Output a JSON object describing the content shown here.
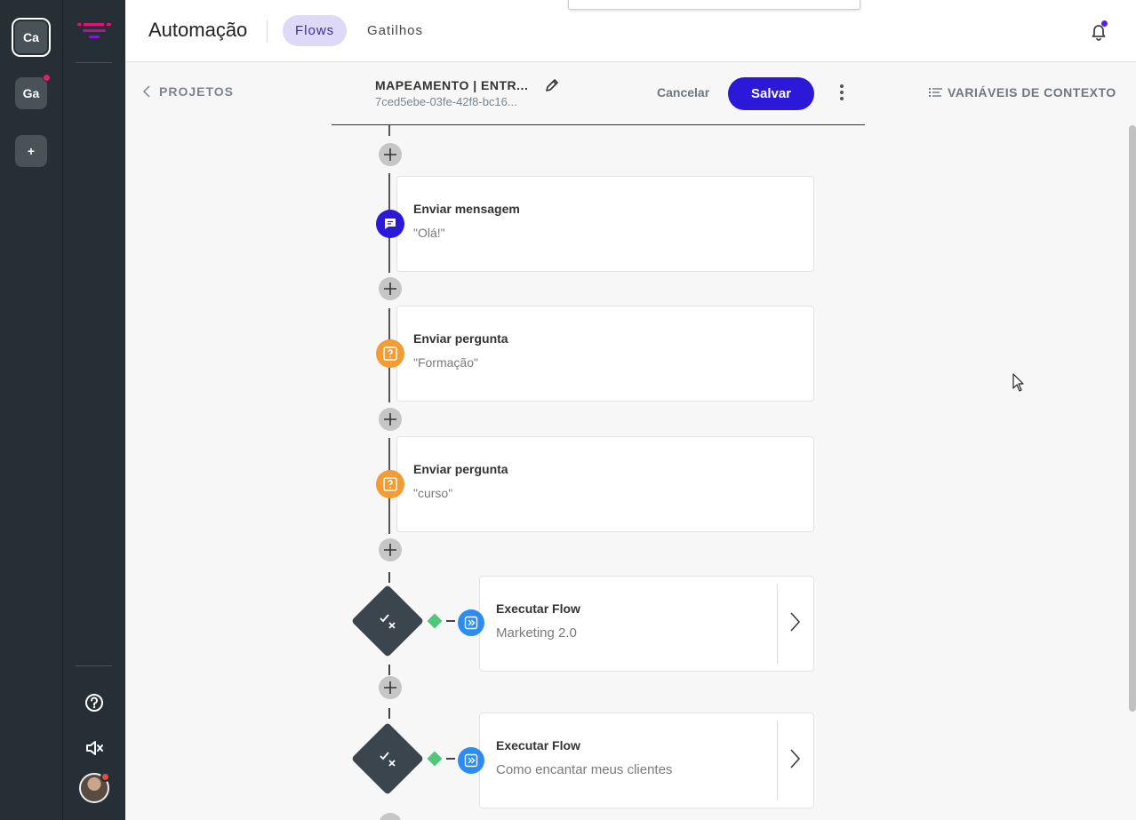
{
  "workspaces": [
    {
      "label": "Ca",
      "active": true
    },
    {
      "label": "Ga",
      "active": false
    },
    {
      "label": "+",
      "active": false
    }
  ],
  "header": {
    "title": "Automação",
    "tabs": [
      {
        "label": "Flows",
        "active": true
      },
      {
        "label": "Gatilhos",
        "active": false
      }
    ]
  },
  "toolbar": {
    "back_label": "PROJETOS",
    "flow_name": "MAPEAMENTO | ENTR...",
    "flow_id": "7ced5ebe-03fe-42f8-bc16...",
    "cancel_label": "Cancelar",
    "save_label": "Salvar",
    "context_vars_label": "VARIÁVEIS DE CONTEXTO"
  },
  "steps": [
    {
      "type": "message",
      "title": "Enviar mensagem",
      "content": "\"Olá!\"",
      "icon": "chat-icon",
      "color": "#2b18d9"
    },
    {
      "type": "question",
      "title": "Enviar pergunta",
      "content": "\"Formação\"",
      "icon": "question-icon",
      "color": "#f39c33"
    },
    {
      "type": "question",
      "title": "Enviar pergunta",
      "content": "\"curso\"",
      "icon": "question-icon",
      "color": "#f39c33"
    }
  ],
  "conditions": [
    {
      "title": "Executar Flow",
      "content": "Marketing 2.0"
    },
    {
      "title": "Executar Flow",
      "content": "Como encantar meus clientes"
    }
  ],
  "colors": {
    "accent": "#2b18d9",
    "sidebar": "#262f36",
    "tab_active_bg": "#ddd9f7",
    "condition_ok": "#4fc87a",
    "execute_flow": "#2d8cf0"
  }
}
